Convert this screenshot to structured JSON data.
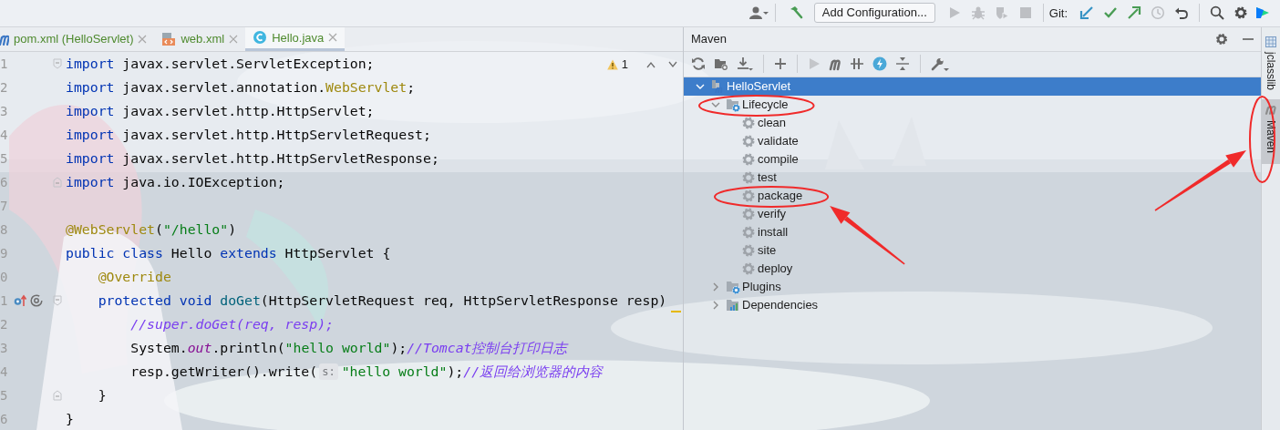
{
  "toolbar": {
    "run_config": "Add Configuration...",
    "run_actions": [
      {
        "kind": "run",
        "disabled": true
      },
      {
        "kind": "debug",
        "disabled": true
      },
      {
        "kind": "coverage",
        "disabled": true
      },
      {
        "kind": "stop",
        "disabled": true
      }
    ],
    "vcs_label": "Git:",
    "vcs_actions": [
      {
        "kind": "update",
        "disabled": false
      },
      {
        "kind": "commit",
        "disabled": false
      },
      {
        "kind": "push",
        "disabled": false
      },
      {
        "kind": "history",
        "disabled": true
      },
      {
        "kind": "rollback",
        "disabled": false
      }
    ]
  },
  "editor_tabs": [
    {
      "label": "pom.xml (HelloServlet)",
      "kind": "maven",
      "selected": false
    },
    {
      "label": "web.xml",
      "kind": "xml",
      "selected": false
    },
    {
      "label": "Hello.java",
      "kind": "java",
      "selected": true
    }
  ],
  "editor": {
    "warning_count": "1",
    "lines": [
      {
        "number": "1",
        "kind": "fold_start",
        "tokens": [
          {
            "kind": "kw",
            "text": "import"
          },
          {
            "kind": "plain",
            "text": " javax.servlet.ServletException;"
          }
        ]
      },
      {
        "number": "2",
        "kind": "plain",
        "tokens": [
          {
            "kind": "kw",
            "text": "import"
          },
          {
            "kind": "plain",
            "text": " javax.servlet.annotation."
          },
          {
            "kind": "ann",
            "text": "WebServlet"
          },
          {
            "kind": "plain",
            "text": ";"
          }
        ]
      },
      {
        "number": "3",
        "kind": "plain",
        "tokens": [
          {
            "kind": "kw",
            "text": "import"
          },
          {
            "kind": "plain",
            "text": " javax.servlet.http.HttpServlet;"
          }
        ]
      },
      {
        "number": "4",
        "kind": "plain",
        "tokens": [
          {
            "kind": "kw",
            "text": "import"
          },
          {
            "kind": "plain",
            "text": " javax.servlet.http.HttpServletRequest;"
          }
        ]
      },
      {
        "number": "5",
        "kind": "plain",
        "tokens": [
          {
            "kind": "kw",
            "text": "import"
          },
          {
            "kind": "plain",
            "text": " javax.servlet.http.HttpServletResponse;"
          }
        ]
      },
      {
        "number": "6",
        "kind": "fold_end",
        "tokens": [
          {
            "kind": "kw",
            "text": "import"
          },
          {
            "kind": "plain",
            "text": " java.io.IOException;"
          }
        ]
      },
      {
        "number": "7",
        "kind": "plain"
      },
      {
        "number": "8",
        "kind": "plain",
        "tokens": [
          {
            "kind": "ann",
            "text": "@WebServlet"
          },
          {
            "kind": "plain",
            "text": "("
          },
          {
            "kind": "str",
            "text": "\"/hello\""
          },
          {
            "kind": "plain",
            "text": ")"
          }
        ]
      },
      {
        "number": "9",
        "kind": "plain",
        "tokens": [
          {
            "kind": "kw",
            "text": "public class"
          },
          {
            "kind": "plain",
            "text": " Hello "
          },
          {
            "kind": "kw",
            "text": "extends"
          },
          {
            "kind": "plain",
            "text": " HttpServlet {"
          }
        ]
      },
      {
        "number": "0",
        "kind": "plain",
        "tokens": [
          {
            "kind": "ann",
            "text": "    @Override"
          }
        ]
      },
      {
        "number": "1",
        "kind": "method",
        "tokens": [
          {
            "kind": "kw",
            "text": "    protected void "
          },
          {
            "kind": "fn",
            "text": "doGet"
          },
          {
            "kind": "plain",
            "text": "(HttpServletRequest req, HttpServletResponse resp)"
          }
        ]
      },
      {
        "number": "2",
        "kind": "plain",
        "tokens": [
          {
            "kind": "cmt",
            "text": "        //super.doGet(req, resp);"
          }
        ]
      },
      {
        "number": "3",
        "kind": "plain",
        "tokens": [
          {
            "kind": "plain",
            "text": "        System."
          },
          {
            "kind": "static",
            "text": "out"
          },
          {
            "kind": "plain",
            "text": ".println("
          },
          {
            "kind": "str",
            "text": "\"hello world\""
          },
          {
            "kind": "plain",
            "text": ");"
          },
          {
            "kind": "cmt",
            "text": "//Tomcat控制台打印日志"
          }
        ]
      },
      {
        "number": "4",
        "kind": "plain",
        "tokens": [
          {
            "kind": "plain",
            "text": "        resp.getWriter().write("
          },
          {
            "kind": "hint",
            "text": "s:"
          },
          {
            "kind": "str",
            "text": "\"hello world\""
          },
          {
            "kind": "plain",
            "text": ");"
          },
          {
            "kind": "cmt",
            "text": "//返回给浏览器的内容"
          }
        ]
      },
      {
        "number": "5",
        "kind": "fold_end",
        "tokens": [
          {
            "kind": "plain",
            "text": "    }"
          }
        ]
      },
      {
        "number": "6",
        "kind": "plain",
        "tokens": [
          {
            "kind": "plain",
            "text": "}"
          }
        ]
      }
    ]
  },
  "maven": {
    "title": "Maven",
    "tree": [
      {
        "label": "HelloServlet",
        "kind": "project",
        "selected": true,
        "expanded": true,
        "circled": false,
        "arrow": false,
        "children": [
          {
            "label": "Lifecycle",
            "kind": "folder",
            "selected": false,
            "expanded": true,
            "circled": true,
            "arrow": false,
            "children": [
              {
                "label": "clean",
                "kind": "goal",
                "selected": false,
                "circled": false,
                "arrow": false
              },
              {
                "label": "validate",
                "kind": "goal",
                "selected": false,
                "circled": false,
                "arrow": false
              },
              {
                "label": "compile",
                "kind": "goal",
                "selected": false,
                "circled": false,
                "arrow": false
              },
              {
                "label": "test",
                "kind": "goal",
                "selected": false,
                "circled": false,
                "arrow": false
              },
              {
                "label": "package",
                "kind": "goal",
                "selected": false,
                "circled": true,
                "arrow": true
              },
              {
                "label": "verify",
                "kind": "goal",
                "selected": false,
                "circled": false,
                "arrow": false
              },
              {
                "label": "install",
                "kind": "goal",
                "selected": false,
                "circled": false,
                "arrow": false
              },
              {
                "label": "site",
                "kind": "goal",
                "selected": false,
                "circled": false,
                "arrow": false
              },
              {
                "label": "deploy",
                "kind": "goal",
                "selected": false,
                "circled": false,
                "arrow": false
              }
            ]
          },
          {
            "label": "Plugins",
            "kind": "folder",
            "selected": false,
            "expanded": false,
            "circled": false,
            "arrow": false
          },
          {
            "label": "Dependencies",
            "kind": "deps",
            "selected": false,
            "expanded": false,
            "circled": false,
            "arrow": false
          }
        ]
      }
    ]
  },
  "side_tabs": [
    {
      "label": "jclasslib",
      "kind": "jclasslib",
      "selected": false,
      "circled": false,
      "arrow": false
    },
    {
      "label": "Maven",
      "kind": "maven",
      "selected": true,
      "circled": true,
      "arrow": true
    }
  ]
}
